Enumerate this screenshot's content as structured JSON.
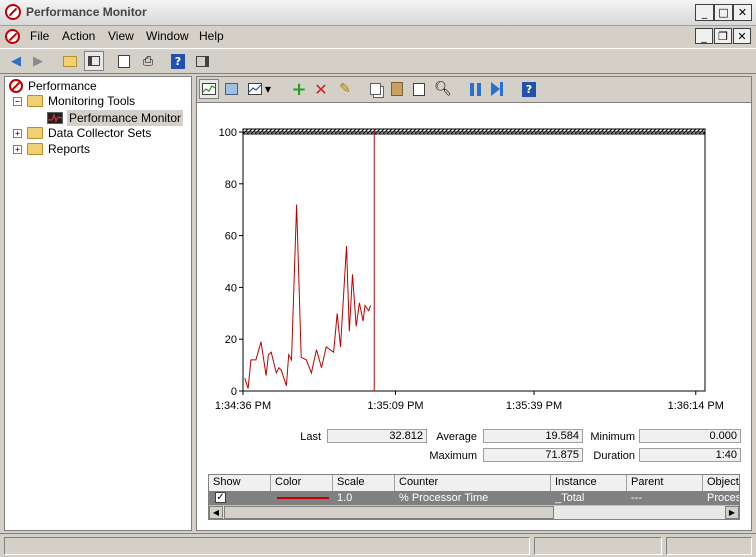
{
  "window": {
    "title": "Performance Monitor"
  },
  "menu": [
    "File",
    "Action",
    "View",
    "Window",
    "Help"
  ],
  "tree": {
    "root": "Performance",
    "children": [
      {
        "label": "Monitoring Tools",
        "expanded": true,
        "children": [
          {
            "label": "Performance Monitor",
            "selected": true
          }
        ]
      },
      {
        "label": "Data Collector Sets",
        "expanded": false
      },
      {
        "label": "Reports",
        "expanded": false
      }
    ]
  },
  "stats": {
    "last_label": "Last",
    "last": "32.812",
    "average_label": "Average",
    "average": "19.584",
    "minimum_label": "Minimum",
    "minimum": "0.000",
    "maximum_label": "Maximum",
    "maximum": "71.875",
    "duration_label": "Duration",
    "duration": "1:40"
  },
  "counters": {
    "headers": [
      "Show",
      "Color",
      "Scale",
      "Counter",
      "Instance",
      "Parent",
      "Object"
    ],
    "rows": [
      {
        "show": true,
        "color": "#c00000",
        "scale": "1.0",
        "counter": "% Processor Time",
        "instance": "_Total",
        "parent": "---",
        "object": "Processor"
      }
    ]
  },
  "colors": {
    "series": "#c00000",
    "cursor": "#c00000",
    "row_highlight": "#808080"
  },
  "chart_data": {
    "type": "line",
    "ylim": [
      0,
      100
    ],
    "yticks": [
      0,
      20,
      40,
      60,
      80,
      100
    ],
    "xticks": [
      "1:34:36 PM",
      "1:35:09 PM",
      "1:35:39 PM",
      "1:36:14 PM"
    ],
    "xlim": [
      0,
      100
    ],
    "xtick_positions": [
      0,
      33,
      63,
      98
    ],
    "cursor_x": 28.4,
    "series": [
      {
        "x": [
          0.4,
          1.1,
          1.7,
          2.8,
          3.9,
          5.0,
          5.5,
          6.1,
          7.2,
          7.8,
          8.3,
          9.4,
          9.9,
          10.5,
          11.6,
          12.6,
          13.7,
          14.8,
          15.9,
          17.0,
          18.0,
          19.6,
          20.4,
          21.1,
          22.4,
          23.0,
          23.7,
          24.5,
          25.2,
          26.0,
          26.4,
          27.2,
          27.6
        ],
        "y": [
          5,
          1,
          12,
          12,
          19,
          6,
          14,
          15,
          7,
          9,
          8,
          2,
          14,
          12,
          72,
          13,
          12,
          7,
          16,
          9,
          17,
          15,
          30,
          17,
          56,
          23,
          45,
          25,
          34,
          27,
          33,
          31,
          33
        ]
      }
    ]
  }
}
